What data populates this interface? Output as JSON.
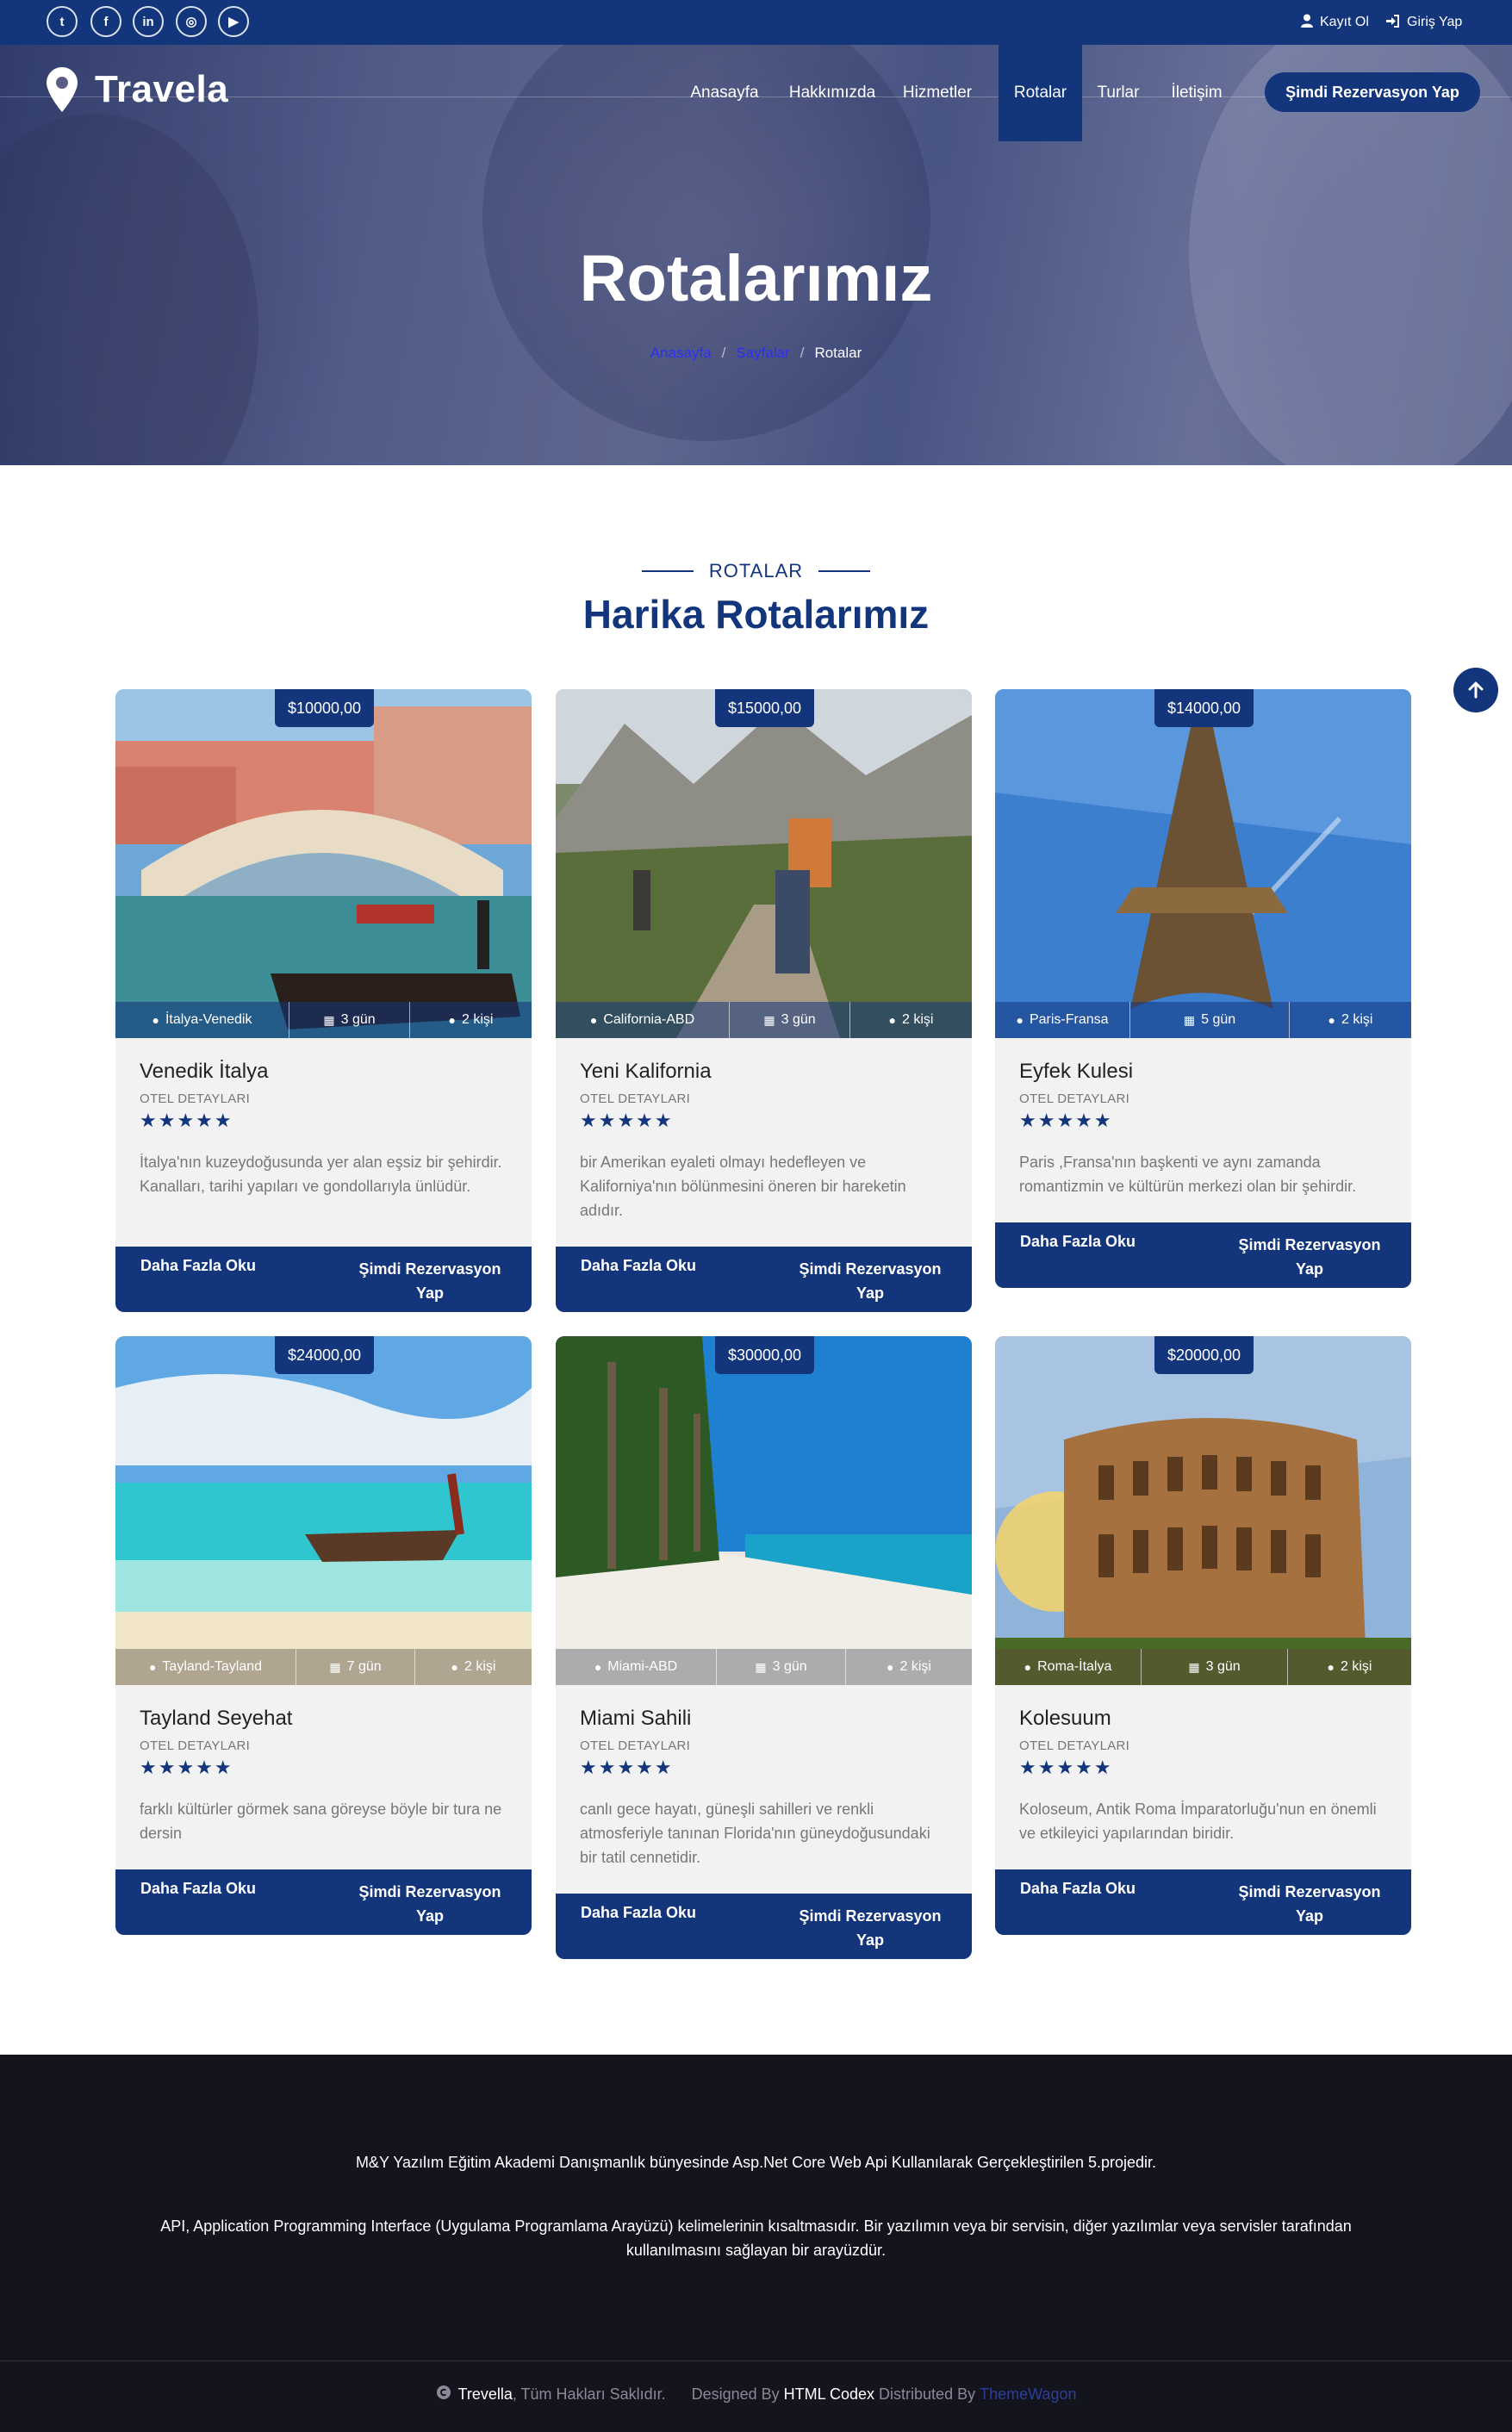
{
  "topbar": {
    "social": [
      "twitter-icon",
      "facebook-icon",
      "linkedin-icon",
      "instagram-icon",
      "youtube-icon"
    ],
    "social_glyphs": [
      "t",
      "f",
      "in",
      "◎",
      "▶"
    ],
    "register": "Kayıt Ol",
    "login": "Giriş Yap"
  },
  "header": {
    "brand": "Travela",
    "nav": [
      "Anasayfa",
      "Hakkımızda",
      "Hizmetler",
      "Rotalar",
      "Turlar",
      "İletişim"
    ],
    "active_nav": "Rotalar",
    "cta": "Şimdi Rezervasyon Yap"
  },
  "hero": {
    "title": "Rotalarımız",
    "breadcrumb": [
      "Anasayfa",
      "Sayfalar",
      "Rotalar"
    ],
    "breadcrumb_sep": "/"
  },
  "section": {
    "subtitle": "ROTALAR",
    "title": "Harika Rotalarımız"
  },
  "cards": [
    {
      "price": "$10000,00",
      "location": "İtalya-Venedik",
      "days": "3 gün",
      "persons": "2 kişi",
      "title": "Venedik İtalya",
      "detail": "OTEL DETAYLARI",
      "stars": "★★★★★",
      "desc": "İtalya'nın kuzeydoğusunda yer alan eşsiz bir şehirdir. Kanalları, tarihi yapıları ve gondollarıyla ünlüdür.",
      "read": "Daha Fazla Oku",
      "book": "Şimdi Rezervasyon Yap"
    },
    {
      "price": "$15000,00",
      "location": "California-ABD",
      "days": "3 gün",
      "persons": "2 kişi",
      "title": "Yeni Kalifornia",
      "detail": "OTEL DETAYLARI",
      "stars": "★★★★★",
      "desc": "bir Amerikan eyaleti olmayı hedefleyen ve Kaliforniya'nın bölünmesini öneren bir hareketin adıdır.",
      "read": "Daha Fazla Oku",
      "book": "Şimdi Rezervasyon Yap"
    },
    {
      "price": "$14000,00",
      "location": "Paris-Fransa",
      "days": "5 gün",
      "persons": "2 kişi",
      "title": "Eyfek Kulesi",
      "detail": "OTEL DETAYLARI",
      "stars": "★★★★★",
      "desc": "Paris ,Fransa'nın başkenti ve aynı zamanda romantizmin ve kültürün merkezi olan bir şehirdir.",
      "read": "Daha Fazla Oku",
      "book": "Şimdi Rezervasyon Yap"
    },
    {
      "price": "$24000,00",
      "location": "Tayland-Tayland",
      "days": "7 gün",
      "persons": "2 kişi",
      "title": "Tayland Seyehat",
      "detail": "OTEL DETAYLARI",
      "stars": "★★★★★",
      "desc": "farklı kültürler görmek sana göreyse böyle bir tura ne dersin",
      "read": "Daha Fazla Oku",
      "book": "Şimdi Rezervasyon Yap"
    },
    {
      "price": "$30000,00",
      "location": "Miami-ABD",
      "days": "3 gün",
      "persons": "2 kişi",
      "title": "Miami Sahili",
      "detail": "OTEL DETAYLARI",
      "stars": "★★★★★",
      "desc": "canlı gece hayatı, güneşli sahilleri ve renkli atmosferiyle tanınan Florida'nın güneydoğusundaki bir tatil cennetidir.",
      "read": "Daha Fazla Oku",
      "book": "Şimdi Rezervasyon Yap"
    },
    {
      "price": "$20000,00",
      "location": "Roma-İtalya",
      "days": "3 gün",
      "persons": "2 kişi",
      "title": "Kolesuum",
      "detail": "OTEL DETAYLARI",
      "stars": "★★★★★",
      "desc": "Koloseum, Antik Roma İmparatorluğu'nun en önemli ve etkileyici yapılarından biridir.",
      "read": "Daha Fazla Oku",
      "book": "Şimdi Rezervasyon Yap"
    }
  ],
  "footer": {
    "line1": "M&Y Yazılım Eğitim Akademi Danışmanlık bünyesinde Asp.Net Core Web Api Kullanılarak Gerçekleştirilen 5.projedir.",
    "line2": "API, Application Programming Interface (Uygulama Programlama Arayüzü) kelimelerinin kısaltmasıdır. Bir yazılımın veya bir servisin, diğer yazılımlar veya servisler tarafından kullanılmasını sağlayan bir arayüzdür.",
    "brand": "Trevella",
    "rights": ", Tüm Hakları Saklıdır.",
    "designed_by": "Designed By",
    "designer": "HTML Codex",
    "distributed_by": "Distributed By",
    "distributor": "ThemeWagon"
  },
  "colors": {
    "primary": "#13357b",
    "footer_bg": "#14141f",
    "card_bg": "#f2f2f2"
  }
}
